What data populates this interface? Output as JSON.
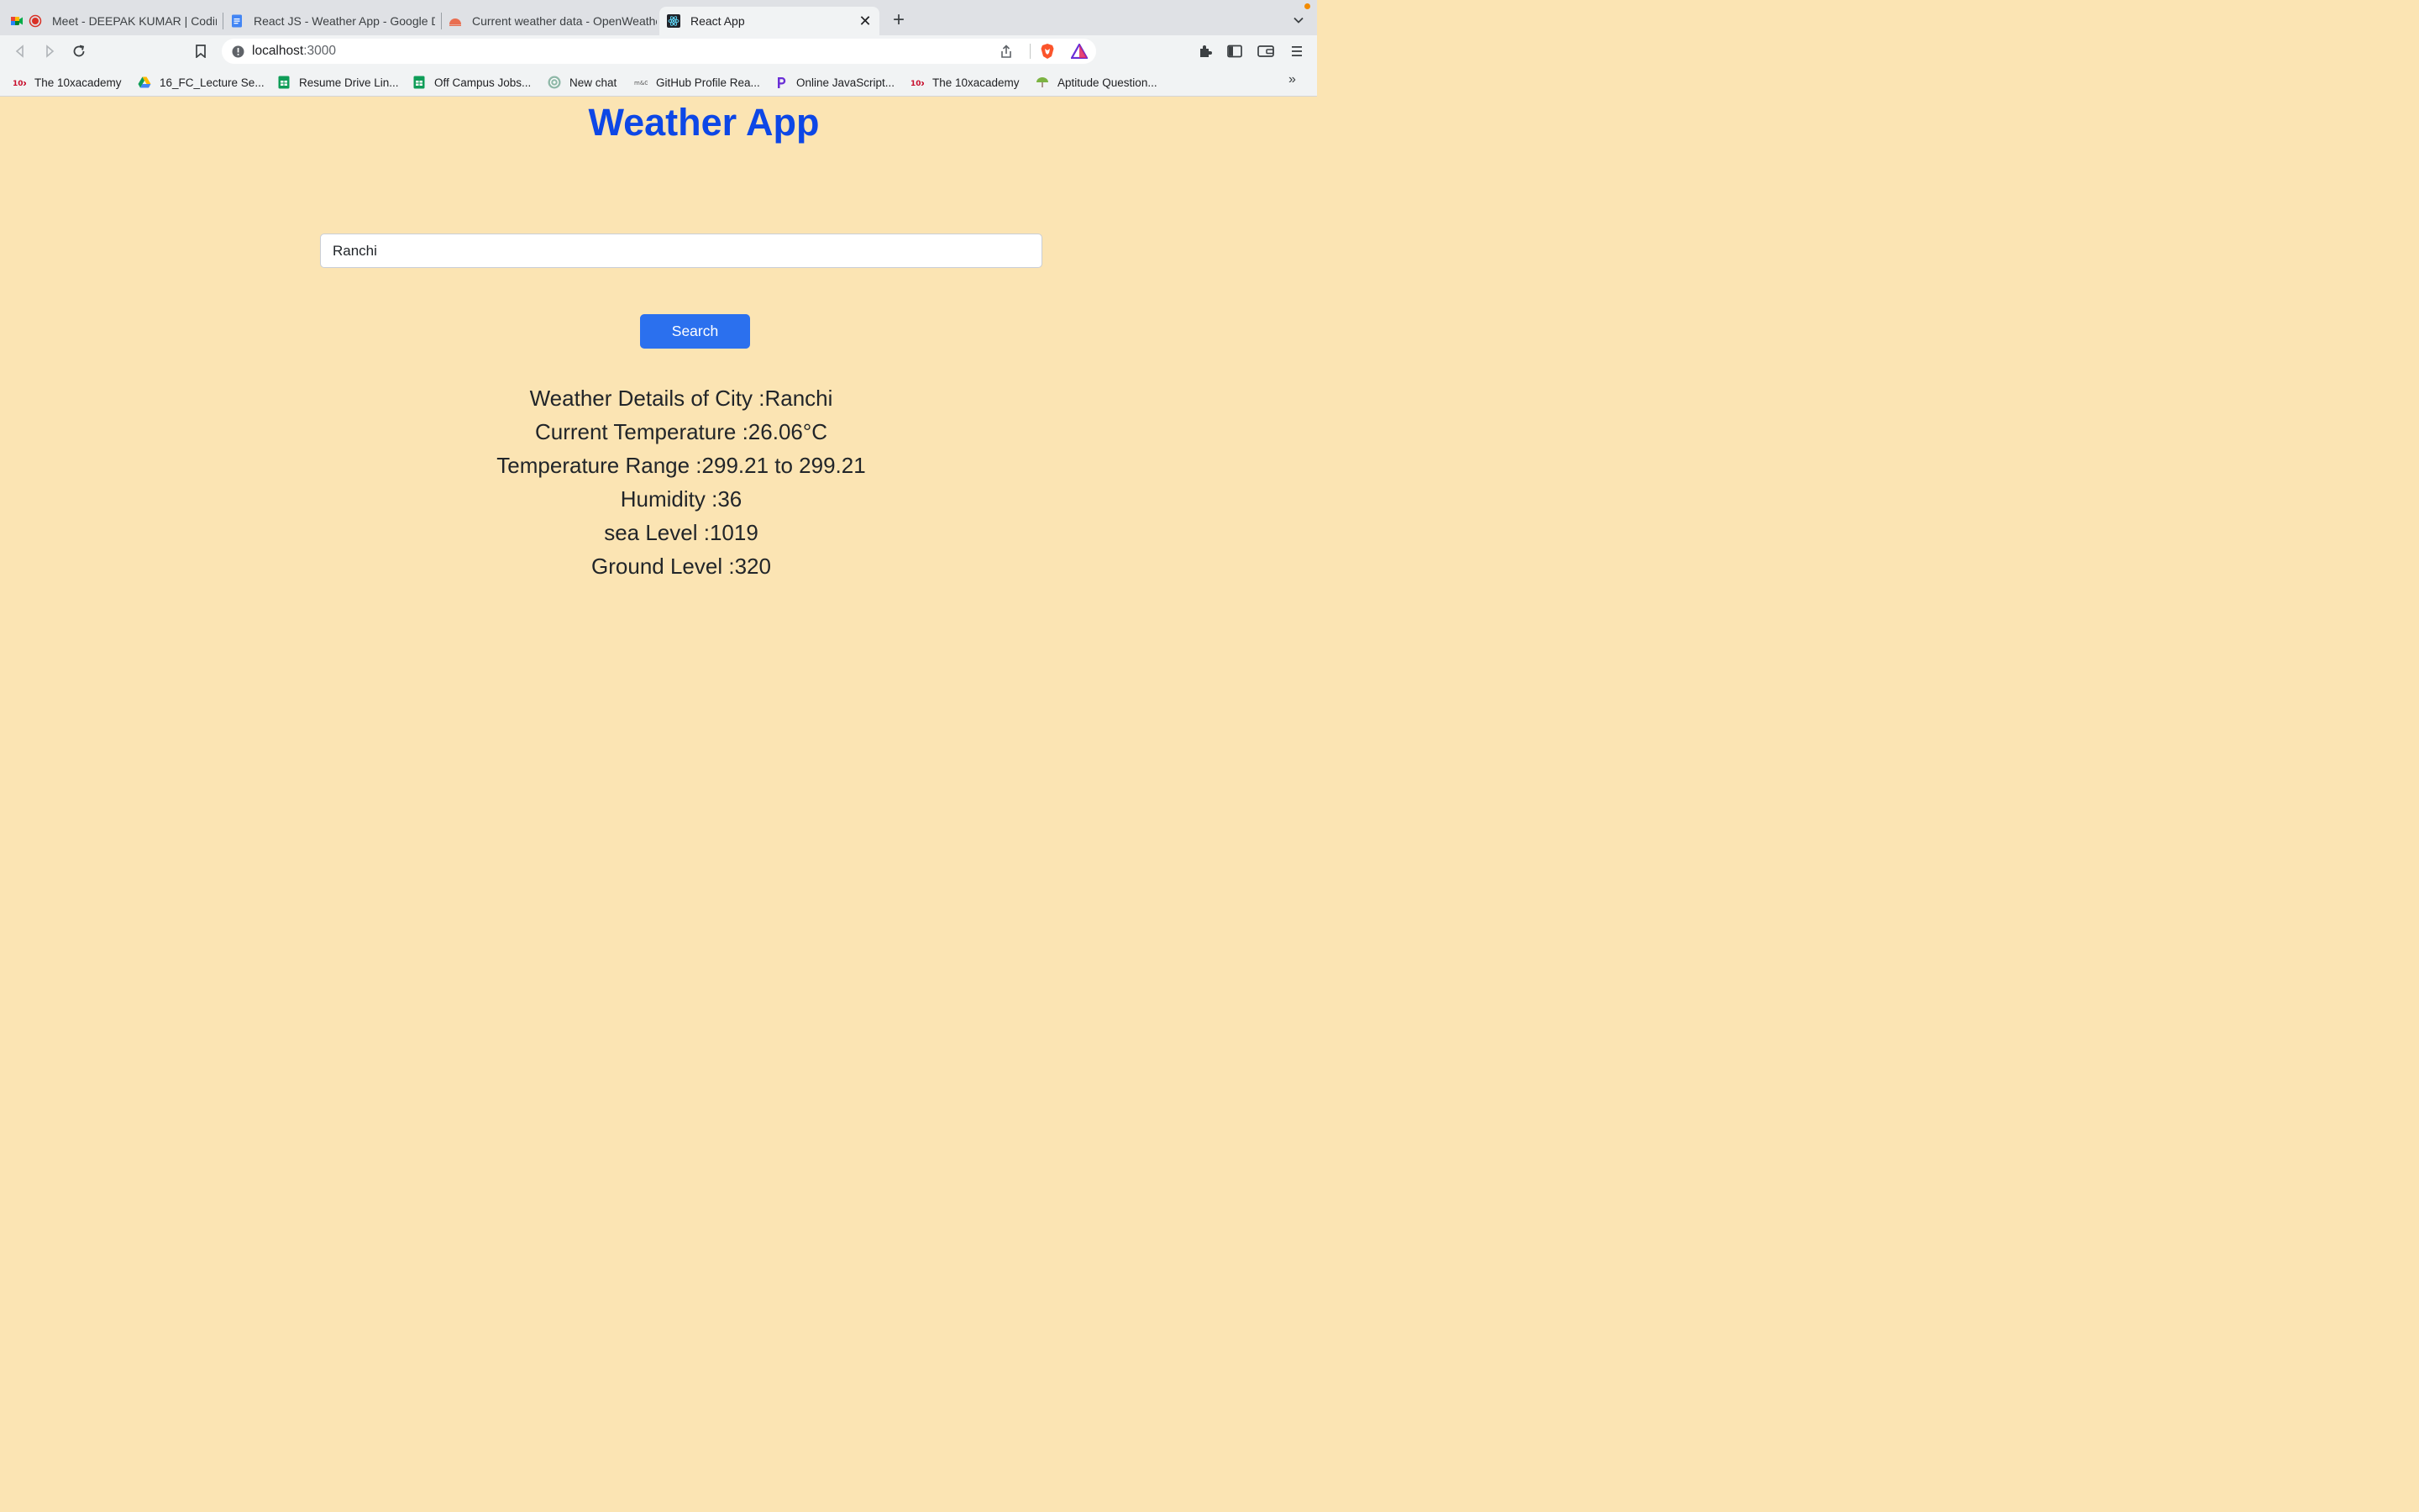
{
  "browser": {
    "tabs": [
      {
        "title": "Meet - DEEPAK KUMAR | Coding",
        "favicon": "google-meet-icon",
        "recording": true
      },
      {
        "title": "React JS - Weather App - Google D",
        "favicon": "google-docs-icon"
      },
      {
        "title": "Current weather data - OpenWeathe",
        "favicon": "openweather-icon"
      },
      {
        "title": "React App",
        "favicon": "react-icon",
        "active": true
      }
    ],
    "address_bar": {
      "host": "localhost",
      "port": ":3000"
    },
    "bookmarks": [
      {
        "label": "The 10xacademy",
        "icon": "10x-icon"
      },
      {
        "label": "16_FC_Lecture Se...",
        "icon": "google-drive-icon"
      },
      {
        "label": "Resume Drive Lin...",
        "icon": "google-sheets-icon"
      },
      {
        "label": "Off Campus Jobs...",
        "icon": "google-sheets-icon"
      },
      {
        "label": "New chat",
        "icon": "openai-icon"
      },
      {
        "label": "GitHub Profile Rea...",
        "icon": "github-readme-icon"
      },
      {
        "label": "Online JavaScript...",
        "icon": "programiz-icon"
      },
      {
        "label": "The 10xacademy",
        "icon": "10x-icon"
      },
      {
        "label": "Aptitude Question...",
        "icon": "indiabix-icon"
      }
    ],
    "bookmarks_more": "»"
  },
  "app": {
    "title": "Weather App",
    "search_input_value": "Ranchi",
    "search_button_label": "Search",
    "details": [
      "Weather Details of City :Ranchi",
      "Current Temperature :26.06°C",
      "Temperature Range :299.21 to 299.21",
      "Humidity :36",
      "sea Level :1019",
      "Ground Level :320"
    ]
  },
  "colors": {
    "page_background": "#fbe4b3",
    "title_color": "#0d47e6",
    "button_color": "#2b70ee",
    "text_color": "#212529"
  }
}
